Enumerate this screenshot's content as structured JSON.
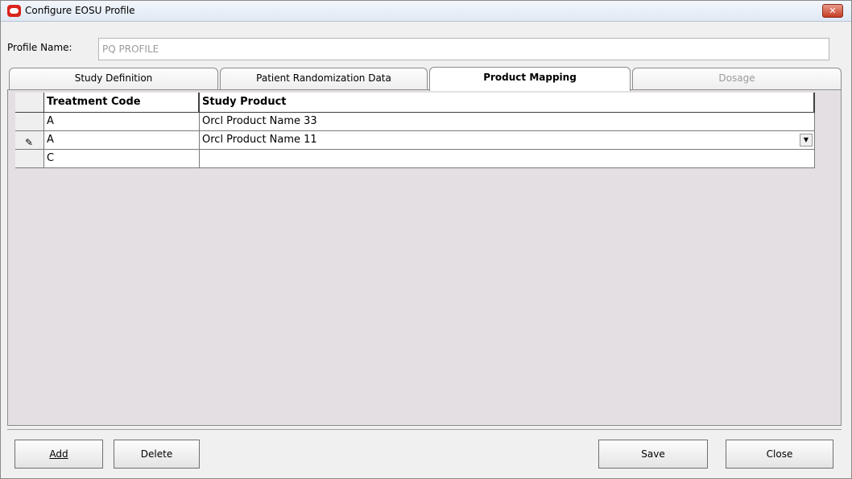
{
  "window": {
    "title": "Configure EOSU Profile",
    "close_glyph": "✕"
  },
  "profile": {
    "label": "Profile Name:",
    "value": "PQ PROFILE"
  },
  "tabs": [
    {
      "label": "Study Definition",
      "state": "normal"
    },
    {
      "label": "Patient Randomization Data",
      "state": "normal"
    },
    {
      "label": "Product Mapping",
      "state": "active"
    },
    {
      "label": "Dosage",
      "state": "disabled"
    }
  ],
  "grid": {
    "columns": [
      "Treatment Code",
      "Study Product"
    ],
    "rows": [
      {
        "treatment_code": "A",
        "study_product": "Orcl Product Name 33",
        "editing": false
      },
      {
        "treatment_code": "A",
        "study_product": "Orcl Product Name 11",
        "editing": true
      },
      {
        "treatment_code": "C",
        "study_product": "",
        "editing": false
      }
    ]
  },
  "buttons": {
    "add": "Add",
    "delete": "Delete",
    "save": "Save",
    "close": "Close"
  },
  "icons": {
    "app": "oracle-icon",
    "edit_row": "pencil-icon",
    "dropdown": "chevron-down-icon"
  }
}
